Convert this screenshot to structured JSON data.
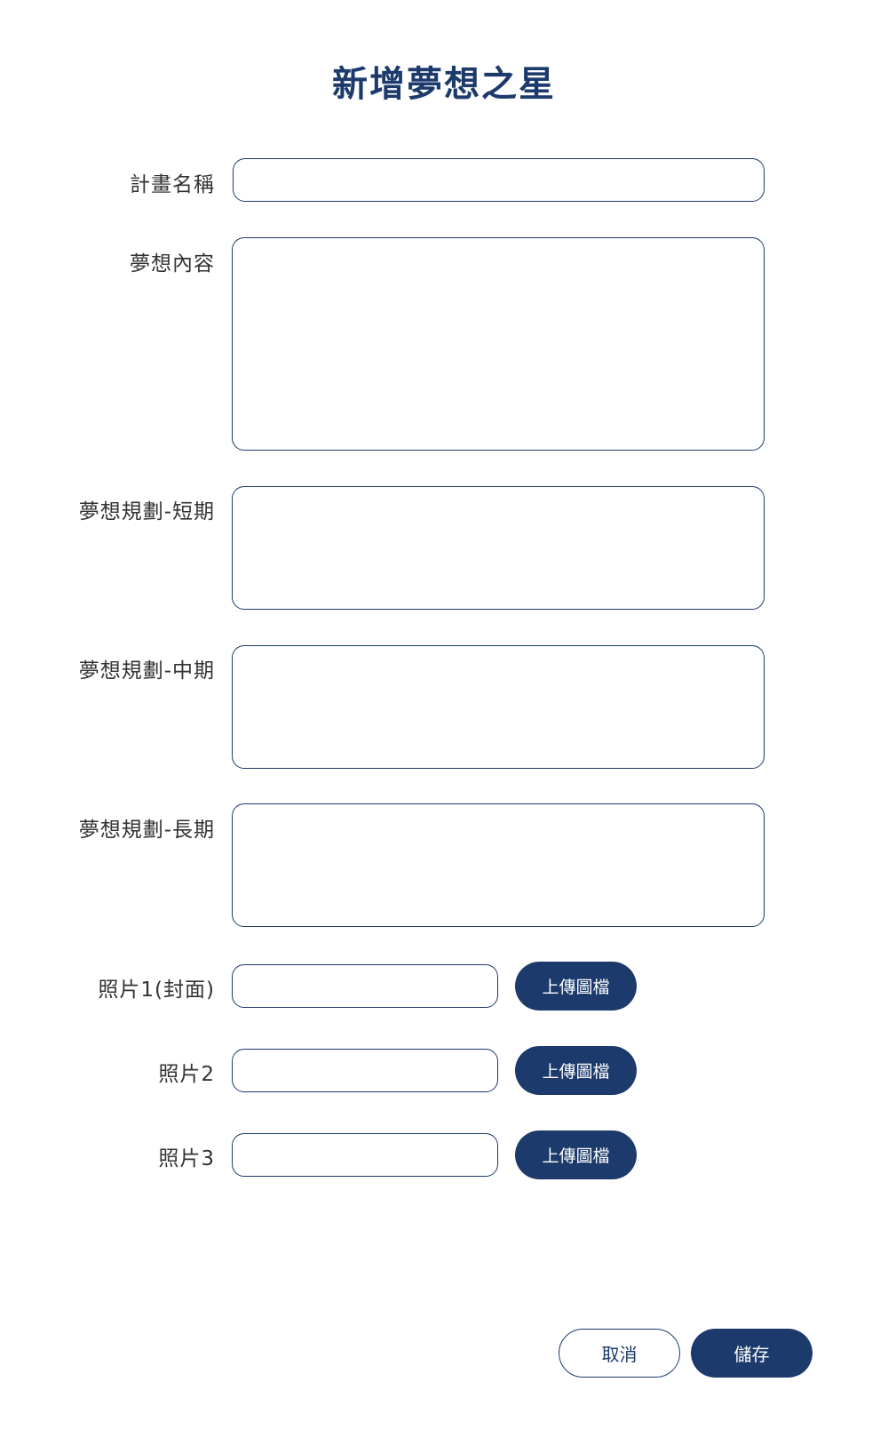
{
  "page": {
    "title": "新增夢想之星"
  },
  "form": {
    "fields": [
      {
        "label": "計畫名稱",
        "value": "",
        "placeholder": ""
      },
      {
        "label": "夢想內容",
        "value": "",
        "placeholder": ""
      },
      {
        "label": "夢想規劃-短期",
        "value": "",
        "placeholder": ""
      },
      {
        "label": "夢想規劃-中期",
        "value": "",
        "placeholder": ""
      },
      {
        "label": "夢想規劃-長期",
        "value": "",
        "placeholder": ""
      }
    ],
    "photos": [
      {
        "label": "照片1(封面)",
        "value": "",
        "upload_label": "上傳圖檔"
      },
      {
        "label": "照片2",
        "value": "",
        "upload_label": "上傳圖檔"
      },
      {
        "label": "照片3",
        "value": "",
        "upload_label": "上傳圖檔"
      }
    ]
  },
  "actions": {
    "cancel_label": "取消",
    "save_label": "儲存"
  },
  "colors": {
    "primary": "#1c3a6b",
    "text": "#333333",
    "background": "#ffffff"
  }
}
